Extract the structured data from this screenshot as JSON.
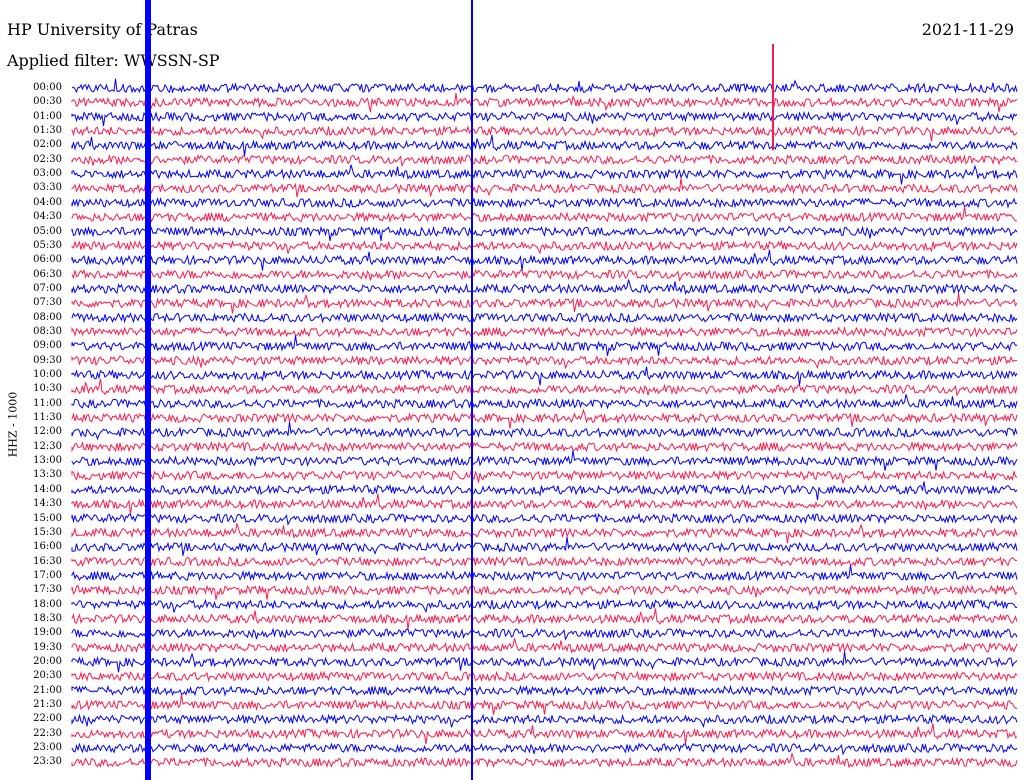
{
  "header": {
    "station": "HP University of Patras",
    "date": "2021-11-29",
    "filter": "Applied filter: WWSSN-SP"
  },
  "channel_label": "HHZ - 1000",
  "colors": {
    "trace_a": "#0000ff",
    "trace_b": "#ff1a4d",
    "background": "#ffffff"
  },
  "time_labels": [
    "00:00",
    "00:30",
    "01:00",
    "01:30",
    "02:00",
    "02:30",
    "03:00",
    "03:30",
    "04:00",
    "04:30",
    "05:00",
    "05:30",
    "06:00",
    "06:30",
    "07:00",
    "07:30",
    "08:00",
    "08:30",
    "09:00",
    "09:30",
    "10:00",
    "10:30",
    "11:00",
    "11:30",
    "12:00",
    "12:30",
    "13:00",
    "13:30",
    "14:00",
    "14:30",
    "15:00",
    "15:30",
    "16:00",
    "16:30",
    "17:00",
    "17:30",
    "18:00",
    "18:30",
    "19:00",
    "19:30",
    "20:00",
    "20:30",
    "21:00",
    "21:30",
    "22:00",
    "22:30",
    "23:00",
    "23:30"
  ]
}
